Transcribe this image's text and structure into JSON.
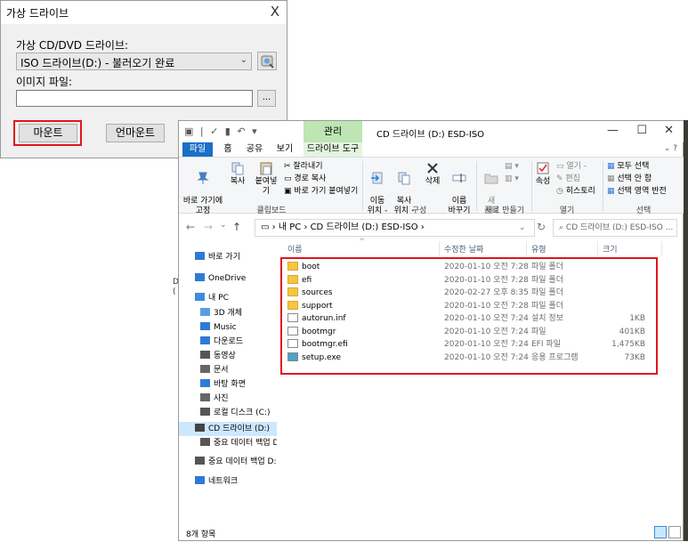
{
  "dialog": {
    "title": "가상 드라이브",
    "close": "X",
    "drive_label": "가상 CD/DVD 드라이브:",
    "drive_value": "ISO 드라이브(D:) - 불러오기 완료",
    "image_label": "이미지 파일:",
    "image_value": "",
    "browse_label": "...",
    "mount_label": "마운트",
    "unmount_label": "언마운트"
  },
  "explorer": {
    "manage_tab": "관리",
    "window_title": "CD 드라이브 (D:) ESD-ISO",
    "controls": {
      "minimize": "—",
      "maximize": "☐",
      "close": "✕"
    },
    "tabs": [
      "파일",
      "홈",
      "공유",
      "보기",
      "드라이브 도구"
    ],
    "ribbon": {
      "pin": "바로 가기에\n고정",
      "copy": "복사",
      "paste": "붙여넣기",
      "cut": "잘라내기",
      "copy_path": "경로 복사",
      "paste_shortcut": "바로 가기 붙여넣기",
      "clipboard_group": "클립보드",
      "move_to": "이동\n위치 -",
      "copy_to": "복사\n위치 -",
      "delete": "삭제",
      "rename": "이름\n바꾸기",
      "organize_group": "구성",
      "new_folder": "새\n폴더",
      "new_group": "새로 만들기",
      "properties": "속성",
      "open": "열기 -",
      "edit": "편집",
      "history": "히스토리",
      "open_group": "열기",
      "select_all": "모두 선택",
      "select_none": "선택 안 함",
      "invert_selection": "선택 영역 반전",
      "select_group": "선택"
    },
    "address": {
      "back": "←",
      "forward": "→",
      "recent": "⌄",
      "up": "↑",
      "path": "› 내 PC › CD 드라이브 (D:) ESD-ISO ›",
      "dropdown": "⌄",
      "refresh": "↻",
      "search_placeholder": "CD 드라이브 (D:) ESD-ISO ..."
    },
    "nav": [
      {
        "label": "바로 가기",
        "icon": "star-icon",
        "color": "#2e7bd6"
      },
      {
        "label": "OneDrive",
        "icon": "cloud-icon",
        "color": "#2e7bd6"
      },
      {
        "label": "내 PC",
        "icon": "pc-icon",
        "color": "#3a8fd9"
      },
      {
        "label": "3D 개체",
        "icon": "cube-icon",
        "color": "#5aa0e0"
      },
      {
        "label": "Music",
        "icon": "music-icon",
        "color": "#2e7bd6"
      },
      {
        "label": "다운로드",
        "icon": "download-icon",
        "color": "#2e7bd6"
      },
      {
        "label": "동영상",
        "icon": "video-icon",
        "color": "#555555"
      },
      {
        "label": "문서",
        "icon": "document-icon",
        "color": "#666666"
      },
      {
        "label": "바탕 화면",
        "icon": "desktop-icon",
        "color": "#2e7bd6"
      },
      {
        "label": "사진",
        "icon": "picture-icon",
        "color": "#666666"
      },
      {
        "label": "로컬 디스크 (C:)",
        "icon": "disk-icon",
        "color": "#555555"
      },
      {
        "label": "CD 드라이브 (D:)",
        "icon": "cd-icon",
        "color": "#444444"
      },
      {
        "label": "중요 데이터 백업 D",
        "icon": "drive-icon",
        "color": "#555555"
      },
      {
        "label": "중요 데이터 백업 D:",
        "icon": "drive-icon",
        "color": "#555555"
      },
      {
        "label": "네트워크",
        "icon": "network-icon",
        "color": "#2e7bd6"
      }
    ],
    "columns": {
      "name": "이름",
      "date": "수정한 날짜",
      "type": "유형",
      "size": "크기"
    },
    "files": [
      {
        "name": "boot",
        "date": "2020-01-10 오전 7:28",
        "type": "파일 폴더",
        "size": "",
        "icon": "folder-icon"
      },
      {
        "name": "efi",
        "date": "2020-01-10 오전 7:28",
        "type": "파일 폴더",
        "size": "",
        "icon": "folder-icon"
      },
      {
        "name": "sources",
        "date": "2020-02-27 오후 8:35",
        "type": "파일 폴더",
        "size": "",
        "icon": "folder-icon"
      },
      {
        "name": "support",
        "date": "2020-01-10 오전 7:28",
        "type": "파일 폴더",
        "size": "",
        "icon": "folder-icon"
      },
      {
        "name": "autorun.inf",
        "date": "2020-01-10 오전 7:24",
        "type": "설치 정보",
        "size": "1KB",
        "icon": "settings-file-icon"
      },
      {
        "name": "bootmgr",
        "date": "2020-01-10 오전 7:24",
        "type": "파일",
        "size": "401KB",
        "icon": "file-icon"
      },
      {
        "name": "bootmgr.efi",
        "date": "2020-01-10 오전 7:24",
        "type": "EFI 파일",
        "size": "1,475KB",
        "icon": "file-icon"
      },
      {
        "name": "setup.exe",
        "date": "2020-01-10 오전 7:24",
        "type": "응용 프로그램",
        "size": "73KB",
        "icon": "setup-icon"
      }
    ],
    "status": "8개 항목"
  },
  "colors": {
    "highlight": "#e0161b",
    "accent": "#1a6fc7",
    "manage_bg": "#bde6b4",
    "folder": "#f6c543"
  }
}
